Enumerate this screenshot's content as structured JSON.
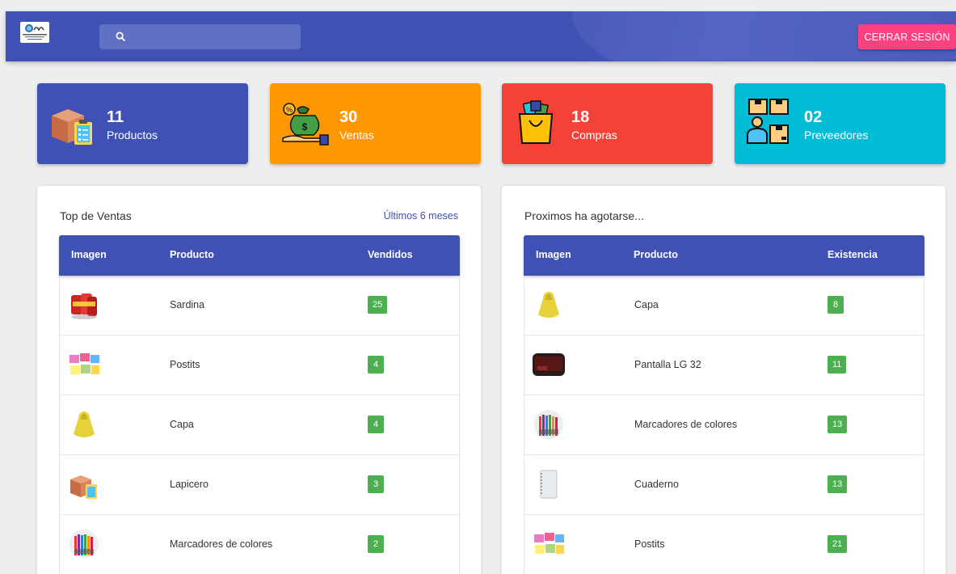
{
  "header": {
    "search_placeholder": "",
    "logout_label": "CERRAR SESIÓN"
  },
  "stats": [
    {
      "value": "11",
      "label": "Productos",
      "color": "#3f51b5",
      "icon": "box-clipboard-icon"
    },
    {
      "value": "30",
      "label": "Ventas",
      "color": "#ff9800",
      "icon": "money-bag-hand-icon"
    },
    {
      "value": "18",
      "label": "Compras",
      "color": "#f44336",
      "icon": "shopping-bag-icon"
    },
    {
      "value": "02",
      "label": "Preveedores",
      "color": "#00bcd4",
      "icon": "supplier-boxes-icon"
    }
  ],
  "top_sales": {
    "title": "Top de Ventas",
    "link": "Últimos 6 meses",
    "columns": [
      "Imagen",
      "Producto",
      "Vendidos"
    ],
    "rows": [
      {
        "product": "Sardina",
        "value": "25",
        "thumb": "sardine-cans-image"
      },
      {
        "product": "Postits",
        "value": "4",
        "thumb": "postits-image"
      },
      {
        "product": "Capa",
        "value": "4",
        "thumb": "raincoat-image"
      },
      {
        "product": "Lapicero",
        "value": "3",
        "thumb": "box-clipboard-image"
      },
      {
        "product": "Marcadores de colores",
        "value": "2",
        "thumb": "markers-image"
      }
    ]
  },
  "low_stock": {
    "title": "Proximos ha agotarse...",
    "columns": [
      "Imagen",
      "Producto",
      "Existencia"
    ],
    "rows": [
      {
        "product": "Capa",
        "value": "8",
        "thumb": "raincoat-image"
      },
      {
        "product": "Pantalla LG 32",
        "value": "11",
        "thumb": "tv-screen-image"
      },
      {
        "product": "Marcadores de colores",
        "value": "13",
        "thumb": "markers-image"
      },
      {
        "product": "Cuaderno",
        "value": "13",
        "thumb": "notebook-image"
      },
      {
        "product": "Postits",
        "value": "21",
        "thumb": "postits-image"
      }
    ]
  }
}
